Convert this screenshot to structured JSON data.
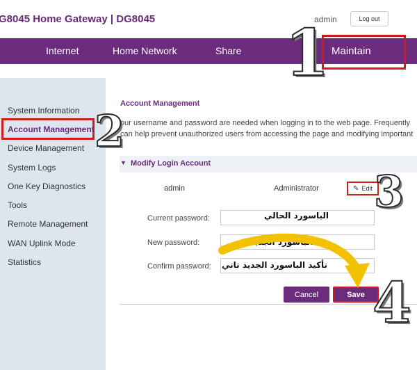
{
  "header": {
    "title": "G8045 Home Gateway  |  DG8045",
    "user": "admin",
    "logout_label": "Log out"
  },
  "nav": {
    "items": [
      "Internet",
      "Home Network",
      "Share",
      "Maintain"
    ]
  },
  "sidebar": {
    "items": [
      "System Information",
      "Account Management",
      "Device Management",
      "System Logs",
      "One Key Diagnostics",
      "Tools",
      "Remote Management",
      "WAN Uplink Mode",
      "Statistics"
    ]
  },
  "main": {
    "title": "Account Management",
    "description_line1": "our username and password are needed when logging in to the web page. Frequently",
    "description_line2": "can help prevent unauthorized users from accessing the page and modifying important",
    "section_title": "Modify Login Account",
    "account": {
      "username": "admin",
      "role": "Administrator",
      "edit_label": "Edit"
    },
    "fields": [
      {
        "label": "Current password:",
        "value": "الباسورد الحالي"
      },
      {
        "label": "New password:",
        "value": "الباسورد الجديد"
      },
      {
        "label": "Confirm password:",
        "value": "تأكيد الباسورد الجديد تاني"
      }
    ],
    "buttons": {
      "cancel": "Cancel",
      "save": "Save"
    }
  },
  "annotations": {
    "step1": "1",
    "step2": "2",
    "step3": "3",
    "step4": "4",
    "highlight_color": "#d11a1a",
    "arrow_color": "#f2c200"
  },
  "colors": {
    "brand_purple": "#6b2c7e",
    "sidebar_bg": "#dde6ee"
  }
}
